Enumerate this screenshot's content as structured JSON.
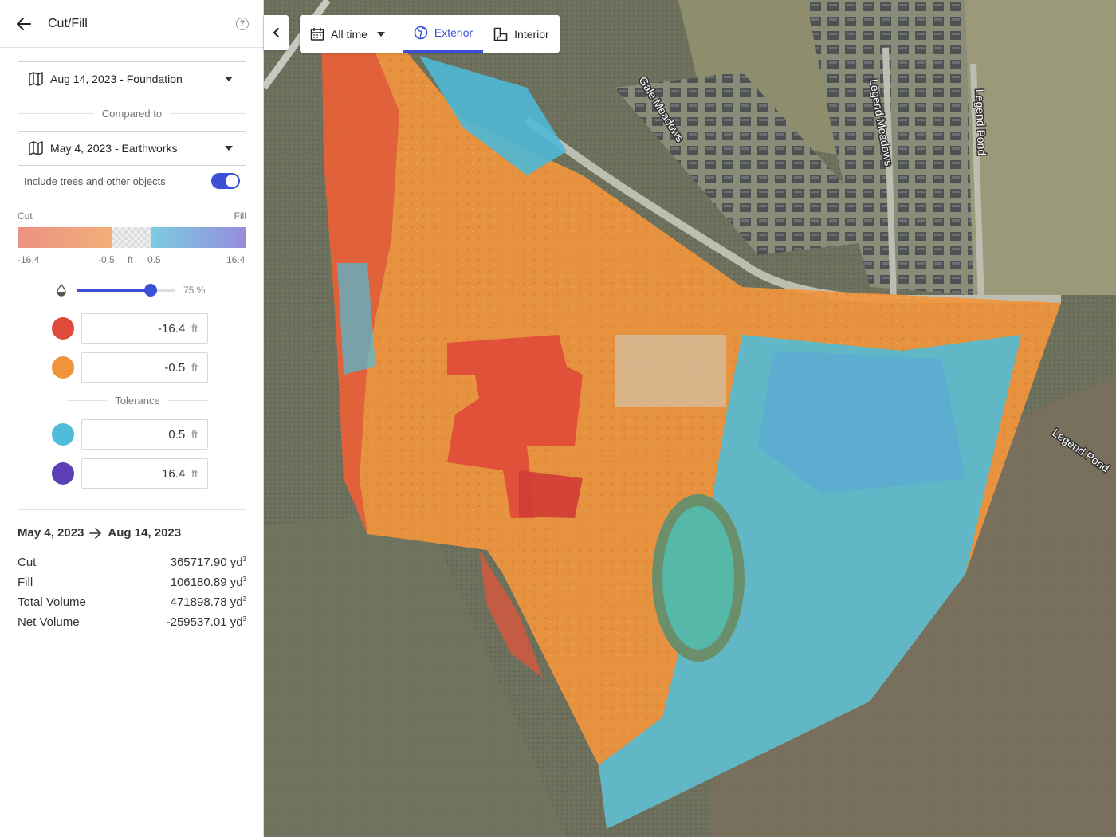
{
  "header": {
    "title": "Cut/Fill"
  },
  "primary_select": {
    "label": "Aug 14, 2023 - Foundation"
  },
  "compared_to_label": "Compared to",
  "compare_select": {
    "label": "May 4, 2023 - Earthworks"
  },
  "include_objects": {
    "label": "Include trees and other objects",
    "enabled": true
  },
  "legend": {
    "cut_label": "Cut",
    "fill_label": "Fill",
    "ticks": [
      "-16.4",
      "-0.5",
      "ft",
      "0.5",
      "16.4"
    ],
    "colors": {
      "cut_strong": "#e04a3a",
      "cut_light": "#f0953c",
      "fill_light": "#4fbcd8",
      "fill_strong": "#5a3fb6"
    }
  },
  "opacity": {
    "value": 0.75,
    "label": "75 %"
  },
  "thresholds": {
    "unit": "ft",
    "cut_strong": {
      "value": "-16.4",
      "color": "#e04a3a"
    },
    "cut_light": {
      "value": "-0.5",
      "color": "#f0953c"
    },
    "tolerance_label": "Tolerance",
    "fill_light": {
      "value": "0.5",
      "color": "#4fbcd8"
    },
    "fill_strong": {
      "value": "16.4",
      "color": "#5a3fb6"
    }
  },
  "summary": {
    "from": "May 4, 2023",
    "to": "Aug 14, 2023",
    "unit": "yd",
    "unit_exp": "3",
    "rows": [
      {
        "label": "Cut",
        "value": "365717.90"
      },
      {
        "label": "Fill",
        "value": "106180.89"
      },
      {
        "label": "Total Volume",
        "value": "471898.78"
      },
      {
        "label": "Net Volume",
        "value": "-259537.01"
      }
    ]
  },
  "toolbar": {
    "time_filter": "All time",
    "exterior": "Exterior",
    "interior": "Interior",
    "active": "Exterior"
  },
  "map": {
    "street_labels": [
      "Gale Meadows",
      "Legend Meadows",
      "Legend Pond",
      "Legend Pond"
    ]
  }
}
